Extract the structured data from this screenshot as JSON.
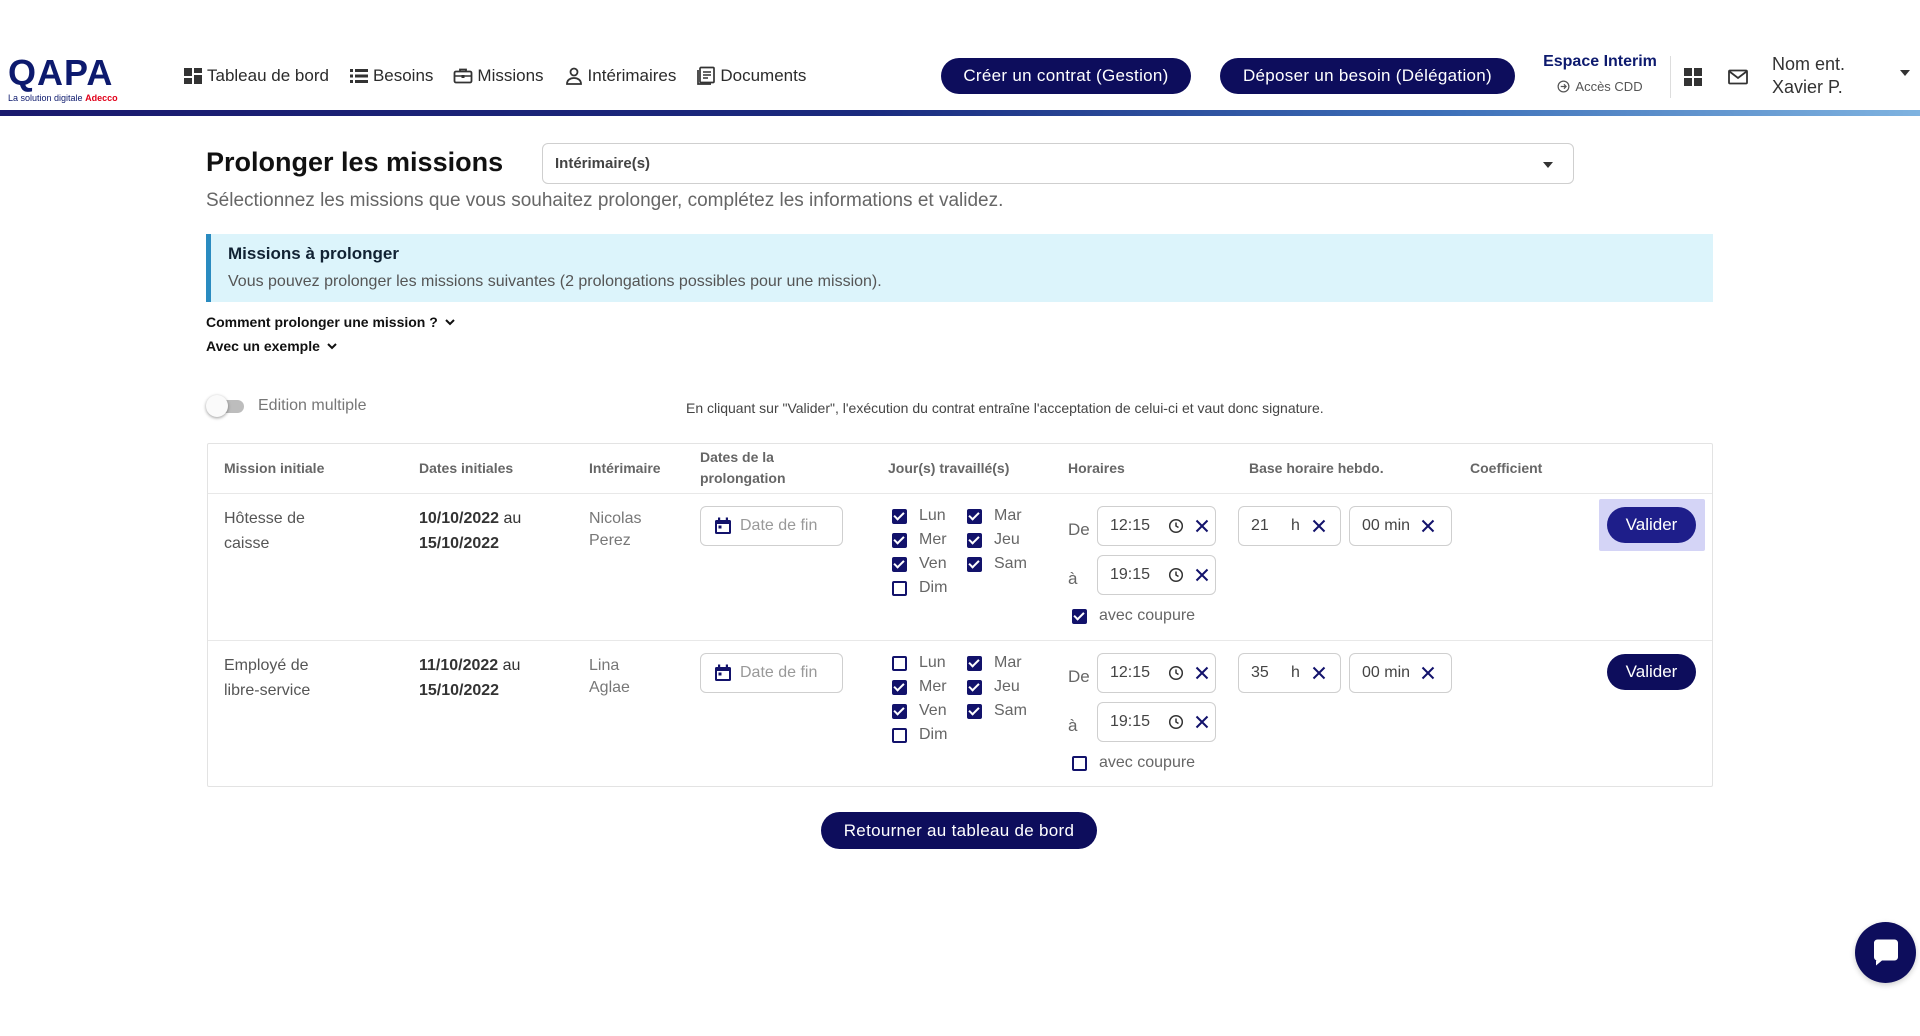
{
  "brand": {
    "name": "QAPA",
    "tagline": "La solution digitale",
    "partner": "Adecco"
  },
  "nav": [
    {
      "label": "Tableau de bord",
      "icon": "dashboard-icon"
    },
    {
      "label": "Besoins",
      "icon": "list-icon"
    },
    {
      "label": "Missions",
      "icon": "briefcase-icon"
    },
    {
      "label": "Intérimaires",
      "icon": "person-icon"
    },
    {
      "label": "Documents",
      "icon": "document-icon"
    }
  ],
  "header": {
    "create_contract": "Créer un contrat (Gestion)",
    "deposit_need": "Déposer un besoin (Délégation)",
    "espace_title": "Espace Interim",
    "espace_sub": "Accès CDD",
    "user_company": "Nom ent.",
    "user_name": "Xavier P."
  },
  "page": {
    "title": "Prolonger les missions",
    "select_placeholder": "Intérimaire(s)",
    "subtitle": "Sélectionnez les missions que vous souhaitez prolonger, complétez les informations et validez.",
    "info_title": "Missions à prolonger",
    "info_text": "Vous pouvez prolonger les missions suivantes (2 prolongations possibles pour une mission).",
    "accordion_how": "Comment prolonger une mission ?",
    "accordion_example": "Avec un exemple",
    "toggle_label": "Edition multiple",
    "legal": "En cliquant sur \"Valider\", l'exécution du contrat entraîne l'acceptation de celui-ci et vaut donc signature.",
    "back_button": "Retourner au tableau de bord"
  },
  "table": {
    "headers": {
      "mission": "Mission initiale",
      "dates": "Dates initiales",
      "interim": "Intérimaire",
      "prolong_1": "Dates de la",
      "prolong_2": "prolongation",
      "days": "Jour(s) travaillé(s)",
      "hours": "Horaires",
      "base": "Base horaire hebdo.",
      "coef": "Coefficient"
    },
    "labels": {
      "date_placeholder": "Date de fin",
      "from": "De",
      "to": "à",
      "break": "avec coupure",
      "hour_unit": "h",
      "validate": "Valider",
      "connector": "au"
    },
    "rows": [
      {
        "mission_1": "Hôtesse de",
        "mission_2": "caisse",
        "start": "10/10/2022",
        "end": "15/10/2022",
        "first": "Nicolas",
        "last": "Perez",
        "days": {
          "Lun": true,
          "Mar": true,
          "Mer": true,
          "Jeu": true,
          "Ven": true,
          "Sam": true,
          "Dim": false
        },
        "from": "12:15",
        "to": "19:15",
        "break": true,
        "hours": "21",
        "minutes": "00 min"
      },
      {
        "mission_1": "Employé de",
        "mission_2": "libre-service",
        "start": "11/10/2022",
        "end": "15/10/2022",
        "first": "Lina",
        "last": "Aglae",
        "days": {
          "Lun": false,
          "Mar": true,
          "Mer": true,
          "Jeu": true,
          "Ven": true,
          "Sam": true,
          "Dim": false
        },
        "from": "12:15",
        "to": "19:15",
        "break": false,
        "hours": "35",
        "minutes": "00 min"
      }
    ]
  },
  "colors": {
    "primary": "#0d0d5c",
    "info_bg": "#dcf4fb",
    "info_border": "#2a8bc0",
    "checkbox": "#12126b"
  }
}
